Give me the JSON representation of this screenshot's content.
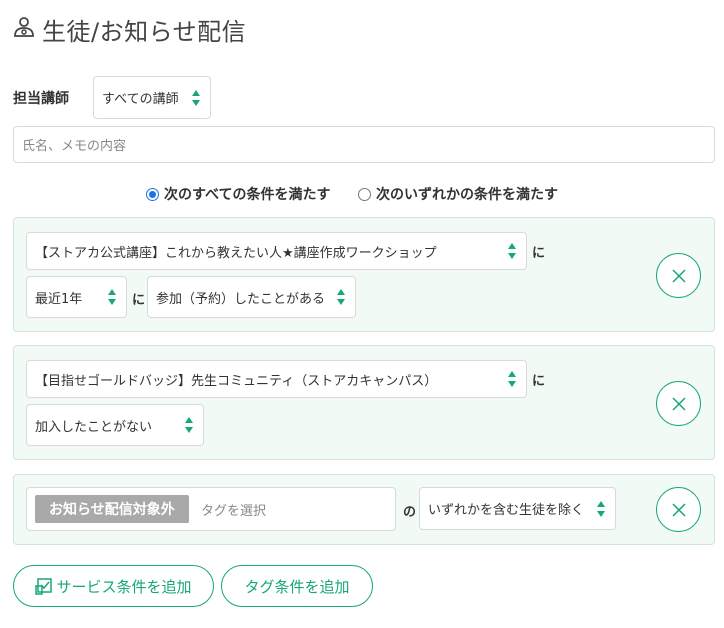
{
  "header": {
    "title": "生徒/お知らせ配信",
    "icon": "user-gear-icon"
  },
  "filter": {
    "teacher_label": "担当講師",
    "teacher_value": "すべての講師",
    "search_placeholder": "氏名、メモの内容"
  },
  "match_mode": {
    "all_label": "次のすべての条件を満たす",
    "any_label": "次のいずれかの条件を満たす",
    "selected": "all"
  },
  "conditions": [
    {
      "course": "【ストアカ公式講座】これから教えたい人★講座作成ワークショップ",
      "ni": "に",
      "period": "最近1年",
      "ni2": "に",
      "action": "参加（予約）したことがある"
    },
    {
      "course": "【目指せゴールドバッジ】先生コミュニティ（ストアカキャンパス）",
      "ni": "に",
      "action": "加入したことがない"
    },
    {
      "tag_chip": "お知らせ配信対象外",
      "tag_placeholder": "タグを選択",
      "no": "の",
      "tag_rule": "いずれかを含む生徒を除く"
    }
  ],
  "buttons": {
    "add_service": "サービス条件を追加",
    "add_tag": "タグ条件を追加"
  },
  "colors": {
    "accent": "#16a874",
    "panel_bg": "#f1faf5",
    "radio": "#1a73e8"
  }
}
